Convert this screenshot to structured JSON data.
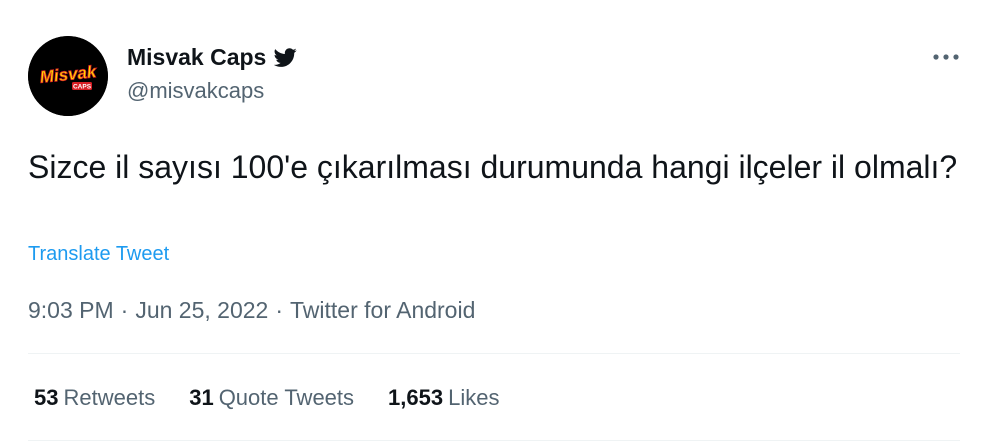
{
  "author": {
    "display_name": "Misvak Caps",
    "handle": "@misvakcaps",
    "avatar_logo_text": "Misvak",
    "avatar_logo_subtext": "CAPS",
    "verified_icon": "twitter-bird-icon"
  },
  "header": {
    "more_icon": "more-options-icon"
  },
  "tweet": {
    "text": "Sizce il sayısı 100'e çıkarılması durumunda hangi ilçeler il olmalı?",
    "translate_label": "Translate Tweet",
    "time": "9:03 PM",
    "date": "Jun 25, 2022",
    "source": "Twitter for Android",
    "separator": "·"
  },
  "stats": {
    "retweets": {
      "count": "53",
      "label": "Retweets"
    },
    "quotes": {
      "count": "31",
      "label": "Quote Tweets"
    },
    "likes": {
      "count": "1,653",
      "label": "Likes"
    }
  },
  "colors": {
    "text": "#0f1419",
    "secondary": "#536471",
    "link": "#1d9bf0",
    "divider": "#eff3f4",
    "logo_yellow": "#ffd500",
    "logo_red": "#d81f26"
  }
}
